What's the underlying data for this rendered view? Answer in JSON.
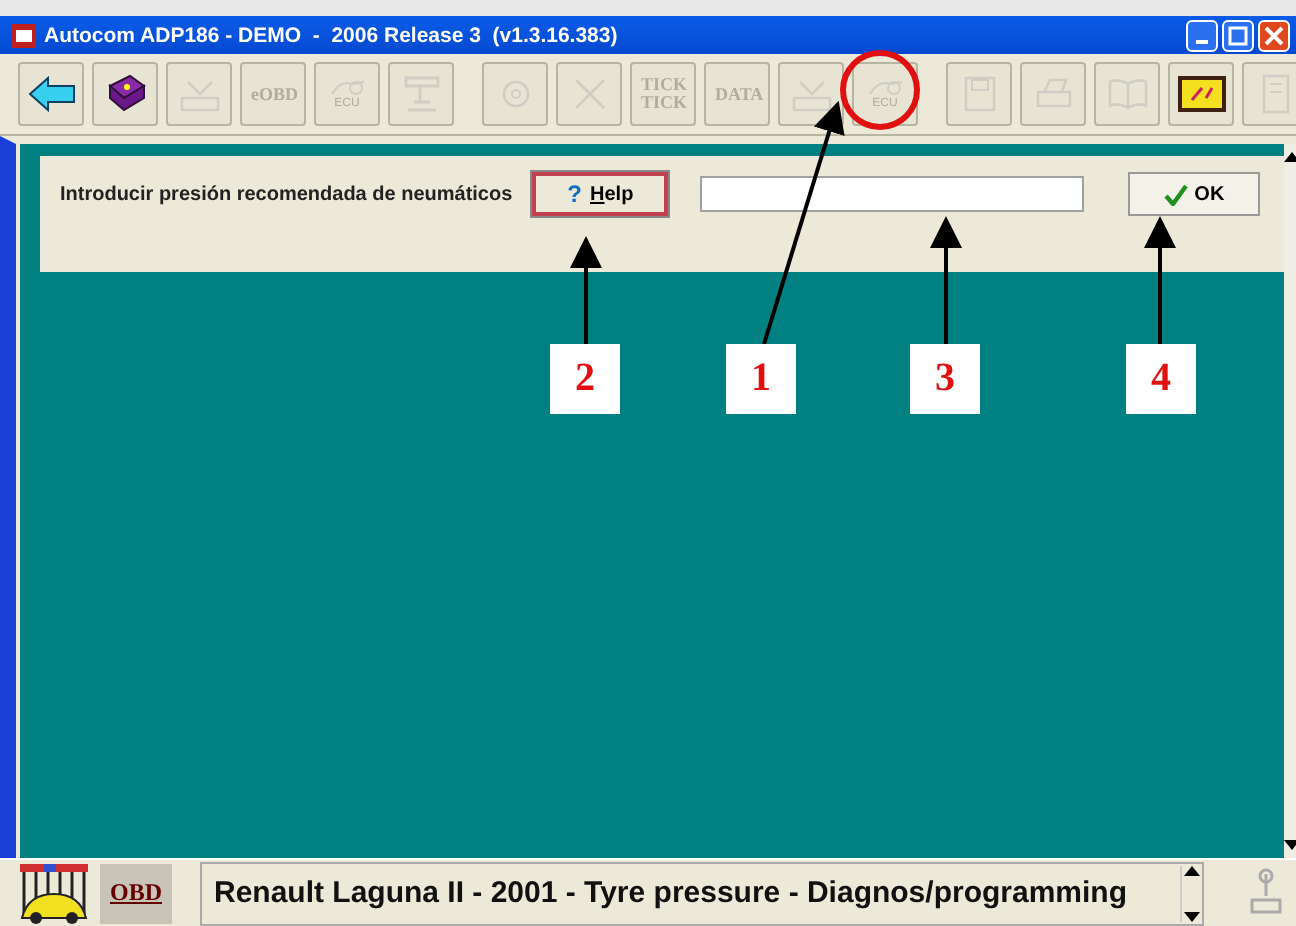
{
  "window": {
    "title": "Autocom ADP186 - DEMO  -  2006 Release 3  (v1.3.16.383)"
  },
  "toolbar": {
    "groups": [
      [
        {
          "kind": "back",
          "disabled": false,
          "highlighted": false
        },
        {
          "kind": "book",
          "disabled": false,
          "highlighted": false
        },
        {
          "kind": "tool",
          "disabled": true,
          "highlighted": false
        },
        {
          "kind": "text",
          "label": "eOBD",
          "disabled": true,
          "highlighted": false
        },
        {
          "kind": "ecu",
          "label": "ECU",
          "disabled": true,
          "highlighted": false
        },
        {
          "kind": "stand",
          "disabled": true,
          "highlighted": false
        }
      ],
      [
        {
          "kind": "circle",
          "disabled": true,
          "highlighted": false
        },
        {
          "kind": "cross",
          "disabled": true,
          "highlighted": false
        },
        {
          "kind": "text",
          "label": "TICK TICK",
          "disabled": true,
          "highlighted": false
        },
        {
          "kind": "text",
          "label": "DATA",
          "disabled": true,
          "highlighted": false
        },
        {
          "kind": "tool",
          "disabled": true,
          "highlighted": false
        },
        {
          "kind": "ecu",
          "label": "ECU",
          "disabled": true,
          "highlighted": true
        }
      ],
      [
        {
          "kind": "save",
          "disabled": true,
          "highlighted": false
        },
        {
          "kind": "printer",
          "disabled": true,
          "highlighted": false
        },
        {
          "kind": "open-book",
          "disabled": true,
          "highlighted": false
        },
        {
          "kind": "board",
          "disabled": false,
          "highlighted": false
        },
        {
          "kind": "device",
          "disabled": true,
          "highlighted": false
        }
      ]
    ]
  },
  "form": {
    "label": "Introducir presión recomendada de neumáticos",
    "help_icon": "?",
    "help_button": "Help",
    "ok_button": "OK"
  },
  "callouts": [
    "2",
    "1",
    "3",
    "4"
  ],
  "status_bar": {
    "logo": "OBD",
    "vehicle": "Renault Laguna II - 2001 - Tyre pressure - Diagnos/programming"
  }
}
